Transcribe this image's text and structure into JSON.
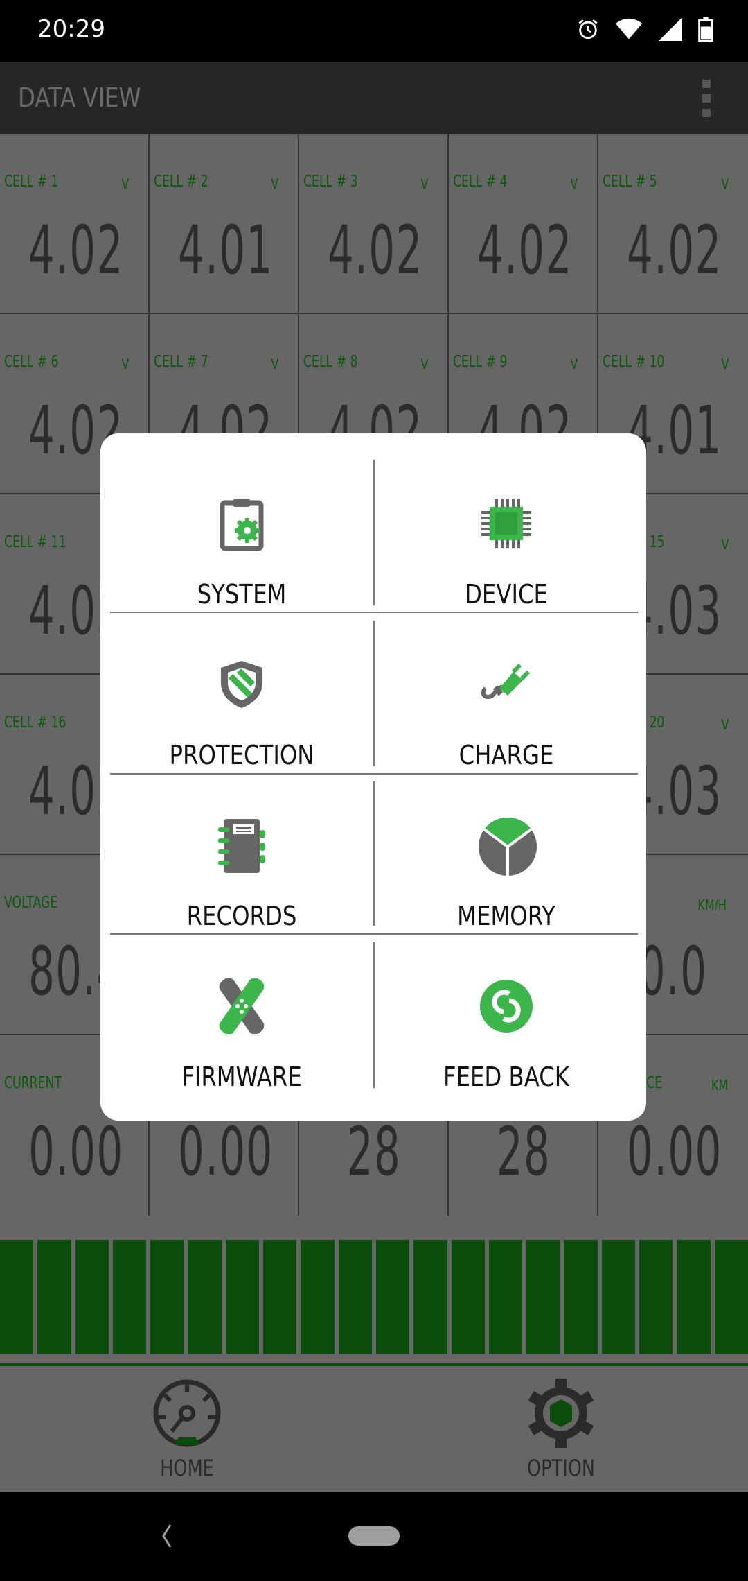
{
  "status_bar": {
    "time": "20:29",
    "icons": [
      "alarm-icon",
      "wifi-icon",
      "signal-icon",
      "battery-icon"
    ]
  },
  "app_bar": {
    "title": "DATA VIEW",
    "menu_icon": "more-vert-icon"
  },
  "colors": {
    "label_green": "#0a5a0a",
    "bar_green": "#0a4d0a",
    "icon_green": "#3cb54a",
    "icon_gray": "#666666"
  },
  "grid": [
    [
      {
        "label": "CELL # 1",
        "unit": "V",
        "value": "4.02"
      },
      {
        "label": "CELL # 2",
        "unit": "V",
        "value": "4.01"
      },
      {
        "label": "CELL # 3",
        "unit": "V",
        "value": "4.02"
      },
      {
        "label": "CELL # 4",
        "unit": "V",
        "value": "4.02"
      },
      {
        "label": "CELL # 5",
        "unit": "V",
        "value": "4.02"
      }
    ],
    [
      {
        "label": "CELL # 6",
        "unit": "V",
        "value": "4.02"
      },
      {
        "label": "CELL # 7",
        "unit": "V",
        "value": "4.02"
      },
      {
        "label": "CELL # 8",
        "unit": "V",
        "value": "4.02"
      },
      {
        "label": "CELL # 9",
        "unit": "V",
        "value": "4.02"
      },
      {
        "label": "CELL # 10",
        "unit": "V",
        "value": "4.01"
      }
    ],
    [
      {
        "label": "CELL # 11",
        "value": "4.02"
      },
      {},
      {},
      {},
      {
        "label": "CELL # 15",
        "unit": "V",
        "value": "4.03"
      }
    ],
    [
      {
        "label": "CELL # 16",
        "value": "4.02"
      },
      {},
      {},
      {},
      {
        "label": "CELL # 20",
        "unit": "V",
        "value": "4.03"
      }
    ],
    [
      {
        "label": "VOLTAGE",
        "value": "80.4"
      },
      {},
      {},
      {},
      {
        "unit": "KM/H",
        "value": "0.0"
      }
    ],
    [
      {
        "label": "CURRENT",
        "value": "0.00"
      },
      {
        "value": "0.00"
      },
      {
        "value": "28"
      },
      {
        "value": "28"
      },
      {
        "label": "DISTANCE",
        "unit": "KM",
        "value": "0.00"
      }
    ]
  ],
  "battery_bar": {
    "segments_total": 20,
    "segments_filled": 20
  },
  "bottom_nav": {
    "home": "HOME",
    "option": "OPTION"
  },
  "dialog": {
    "items": [
      {
        "label": "SYSTEM",
        "icon": "clipboard-gear-icon"
      },
      {
        "label": "DEVICE",
        "icon": "chip-icon"
      },
      {
        "label": "PROTECTION",
        "icon": "shield-icon"
      },
      {
        "label": "CHARGE",
        "icon": "plug-icon"
      },
      {
        "label": "RECORDS",
        "icon": "notebook-icon"
      },
      {
        "label": "MEMORY",
        "icon": "pie-chart-icon"
      },
      {
        "label": "FIRMWARE",
        "icon": "bandage-icon"
      },
      {
        "label": "FEED BACK",
        "icon": "feedback-icon"
      }
    ]
  }
}
